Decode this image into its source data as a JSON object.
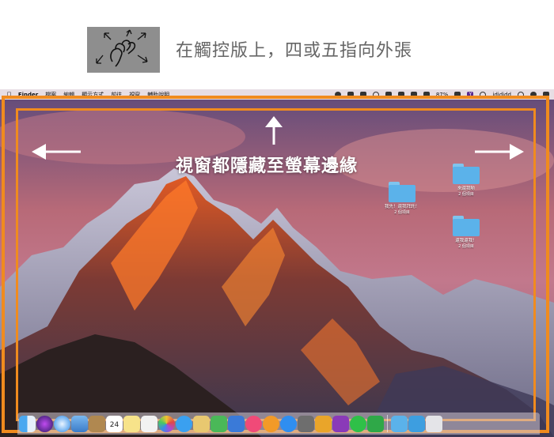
{
  "instruction": {
    "text": "在觸控版上，四或五指向外張"
  },
  "overlay": {
    "text": "視窗都隱藏至螢幕邊緣"
  },
  "menubar": {
    "apple": "",
    "app_name": "Finder",
    "menus": [
      "檔案",
      "編輯",
      "顯示方式",
      "前往",
      "視窗",
      "輔助說明"
    ],
    "battery": "87%",
    "user": "idididd"
  },
  "desktop": {
    "folders": [
      {
        "name": "我先！還我拜託！",
        "sub": "2 個項目"
      },
      {
        "name": "來還我喲",
        "sub": "2 個項目"
      },
      {
        "name": "還我還我！",
        "sub": "2 個項目"
      }
    ]
  },
  "colors": {
    "frame": "#f08b1e",
    "folder": "#5bb2ea"
  },
  "dock": {
    "calendar_day": "24",
    "apps": [
      "finder-icon",
      "siri-icon",
      "safari-icon",
      "mail-icon",
      "contacts-icon",
      "calendar-icon",
      "notes-icon",
      "reminders-icon",
      "photos-icon",
      "messages-icon",
      "facetime-icon",
      "numbers-icon",
      "keynote-icon",
      "itunes-icon",
      "ibooks-icon",
      "appstore-icon",
      "preferences-icon",
      "tes-icon",
      "onenote-icon",
      "line-icon",
      "evernote-icon"
    ]
  }
}
